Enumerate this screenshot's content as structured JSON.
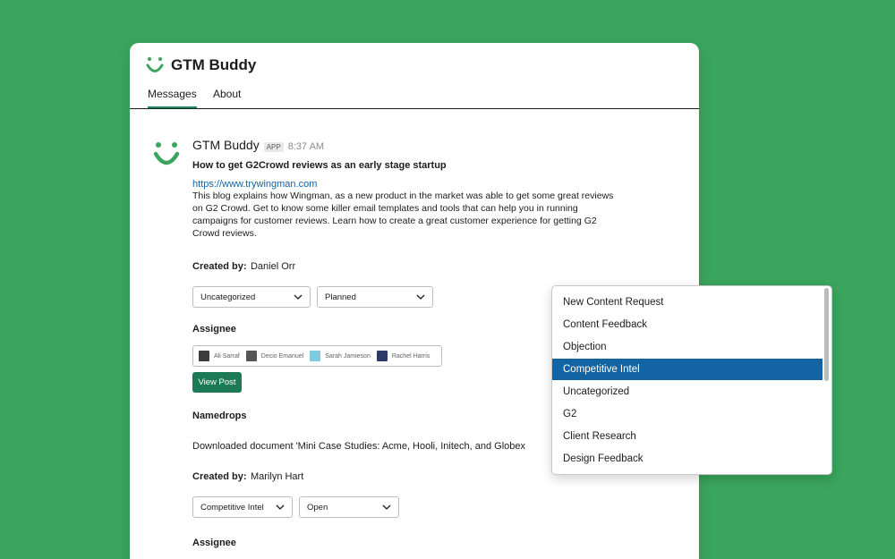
{
  "app": {
    "name": "GTM Buddy"
  },
  "tabs": [
    {
      "label": "Messages"
    },
    {
      "label": "About"
    }
  ],
  "message": {
    "sender": "GTM Buddy",
    "badge": "APP",
    "time": "8:37 AM",
    "title": "How to get G2Crowd reviews as an early stage startup",
    "link": "https://www.trywingman.com",
    "description": "This blog explains how Wingman, as a new product in the market was able to get some great reviews on G2 Crowd. Get to know some killer email templates and tools that can help you in running campaigns for customer reviews. Learn how to create a great customer experience for getting G2 Crowd reviews.",
    "created_by_label": "Created by:",
    "created_by": "Daniel Orr",
    "category_select": "Uncategorized",
    "status_select": "Planned",
    "assignee_label": "Assignee",
    "assignees": [
      {
        "name": "Ali Sarraf",
        "color": "#3b3b3b"
      },
      {
        "name": "Decio Emanuel",
        "color": "#555555"
      },
      {
        "name": "Sarah Jamieson",
        "color": "#7fc9e0"
      },
      {
        "name": "Rachel Harris",
        "color": "#2b3a67"
      }
    ],
    "view_post": "View Post"
  },
  "namedrops": {
    "label": "Namedrops",
    "text": "Downloaded document 'Mini Case Studies: Acme, Hooli, Initech, and Globex",
    "created_by_label": "Created by:",
    "created_by": "Marilyn Hart",
    "category_select": "Competitive Intel",
    "status_select": "Open",
    "assignee_label": "Assignee"
  },
  "dropdown": {
    "options": [
      "New Content Request",
      "Content Feedback",
      "Objection",
      "Competitive Intel",
      "Uncategorized",
      "G2",
      "Client Research",
      "Design Feedback"
    ],
    "selected": "Competitive Intel"
  },
  "colors": {
    "background": "#3aa55c",
    "accent": "#1d7a56",
    "selection": "#1264a3",
    "link": "#1264a3"
  }
}
